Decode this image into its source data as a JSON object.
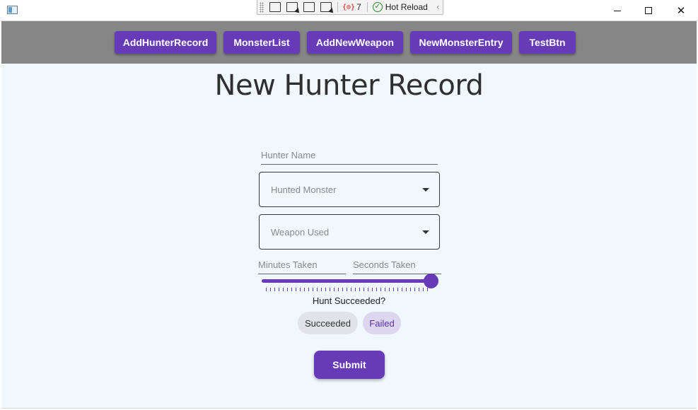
{
  "window": {
    "title": "",
    "icon": "app-window-icon",
    "controls": {
      "minimize": "minimize-icon",
      "maximize": "maximize-icon",
      "close": "close-icon",
      "close_glyph": "✕"
    }
  },
  "debug_toolbar": {
    "error_count": "7",
    "hot_reload_label": "Hot Reload",
    "hot_reload_status_color": "#2d8a2d"
  },
  "nav": {
    "buttons": [
      {
        "label": "AddHunterRecord"
      },
      {
        "label": "MonsterList"
      },
      {
        "label": "AddNewWeapon"
      },
      {
        "label": "NewMonsterEntry"
      },
      {
        "label": "TestBtn"
      }
    ],
    "background": "#868686",
    "button_color": "#673ab7"
  },
  "page": {
    "title": "New Hunter Record",
    "background": "#f0f7fd"
  },
  "form": {
    "hunter_name_placeholder": "Hunter Name",
    "hunted_monster_placeholder": "Hunted Monster",
    "weapon_used_placeholder": "Weapon Used",
    "minutes_taken_placeholder": "Minutes Taken",
    "seconds_taken_placeholder": "Seconds Taken",
    "slider_value_fraction": 1.0,
    "question": "Hunt Succeeded?",
    "chips": {
      "succeeded": "Succeeded",
      "failed": "Failed",
      "selected": "Failed"
    },
    "submit_label": "Submit"
  }
}
